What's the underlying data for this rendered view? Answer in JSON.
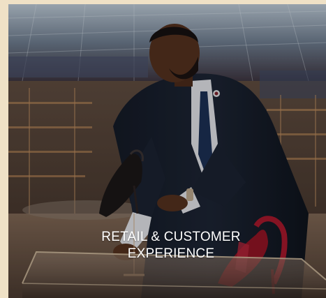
{
  "caption": {
    "line1": "RETAIL & CUSTOMER",
    "line2": "EXPERIENCE"
  },
  "colors": {
    "frame": "#efe1c6",
    "caption_text": "#ffffff"
  }
}
